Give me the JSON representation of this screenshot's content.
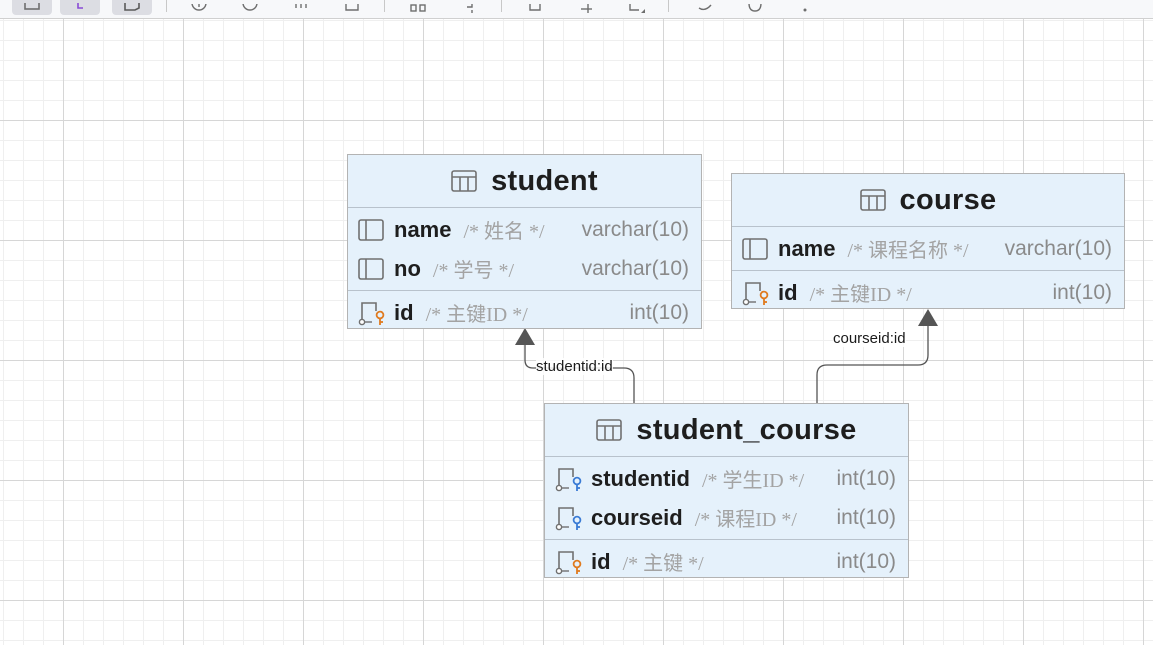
{
  "entities": {
    "student": {
      "title": "student",
      "rows": [
        {
          "name": "name",
          "comment": "/* 姓名 */",
          "type": "varchar(10)"
        },
        {
          "name": "no",
          "comment": "/* 学号 */",
          "type": "varchar(10)"
        },
        {
          "name": "id",
          "comment": "/* 主键ID */",
          "type": "int(10)"
        }
      ]
    },
    "course": {
      "title": "course",
      "rows": [
        {
          "name": "name",
          "comment": "/* 课程名称 */",
          "type": "varchar(10)"
        },
        {
          "name": "id",
          "comment": "/* 主键ID */",
          "type": "int(10)"
        }
      ]
    },
    "student_course": {
      "title": "student_course",
      "rows": [
        {
          "name": "studentid",
          "comment": "/* 学生ID */",
          "type": "int(10)"
        },
        {
          "name": "courseid",
          "comment": "/* 课程ID */",
          "type": "int(10)"
        },
        {
          "name": "id",
          "comment": "/* 主键 */",
          "type": "int(10)"
        }
      ]
    }
  },
  "relations": {
    "student_fk": "studentid:id",
    "course_fk": "courseid:id"
  },
  "colors": {
    "entity_fill": "#e5f1fb",
    "primary_key": "#e07a1e",
    "foreign_key": "#3a7bd5",
    "edge": "#555555"
  }
}
